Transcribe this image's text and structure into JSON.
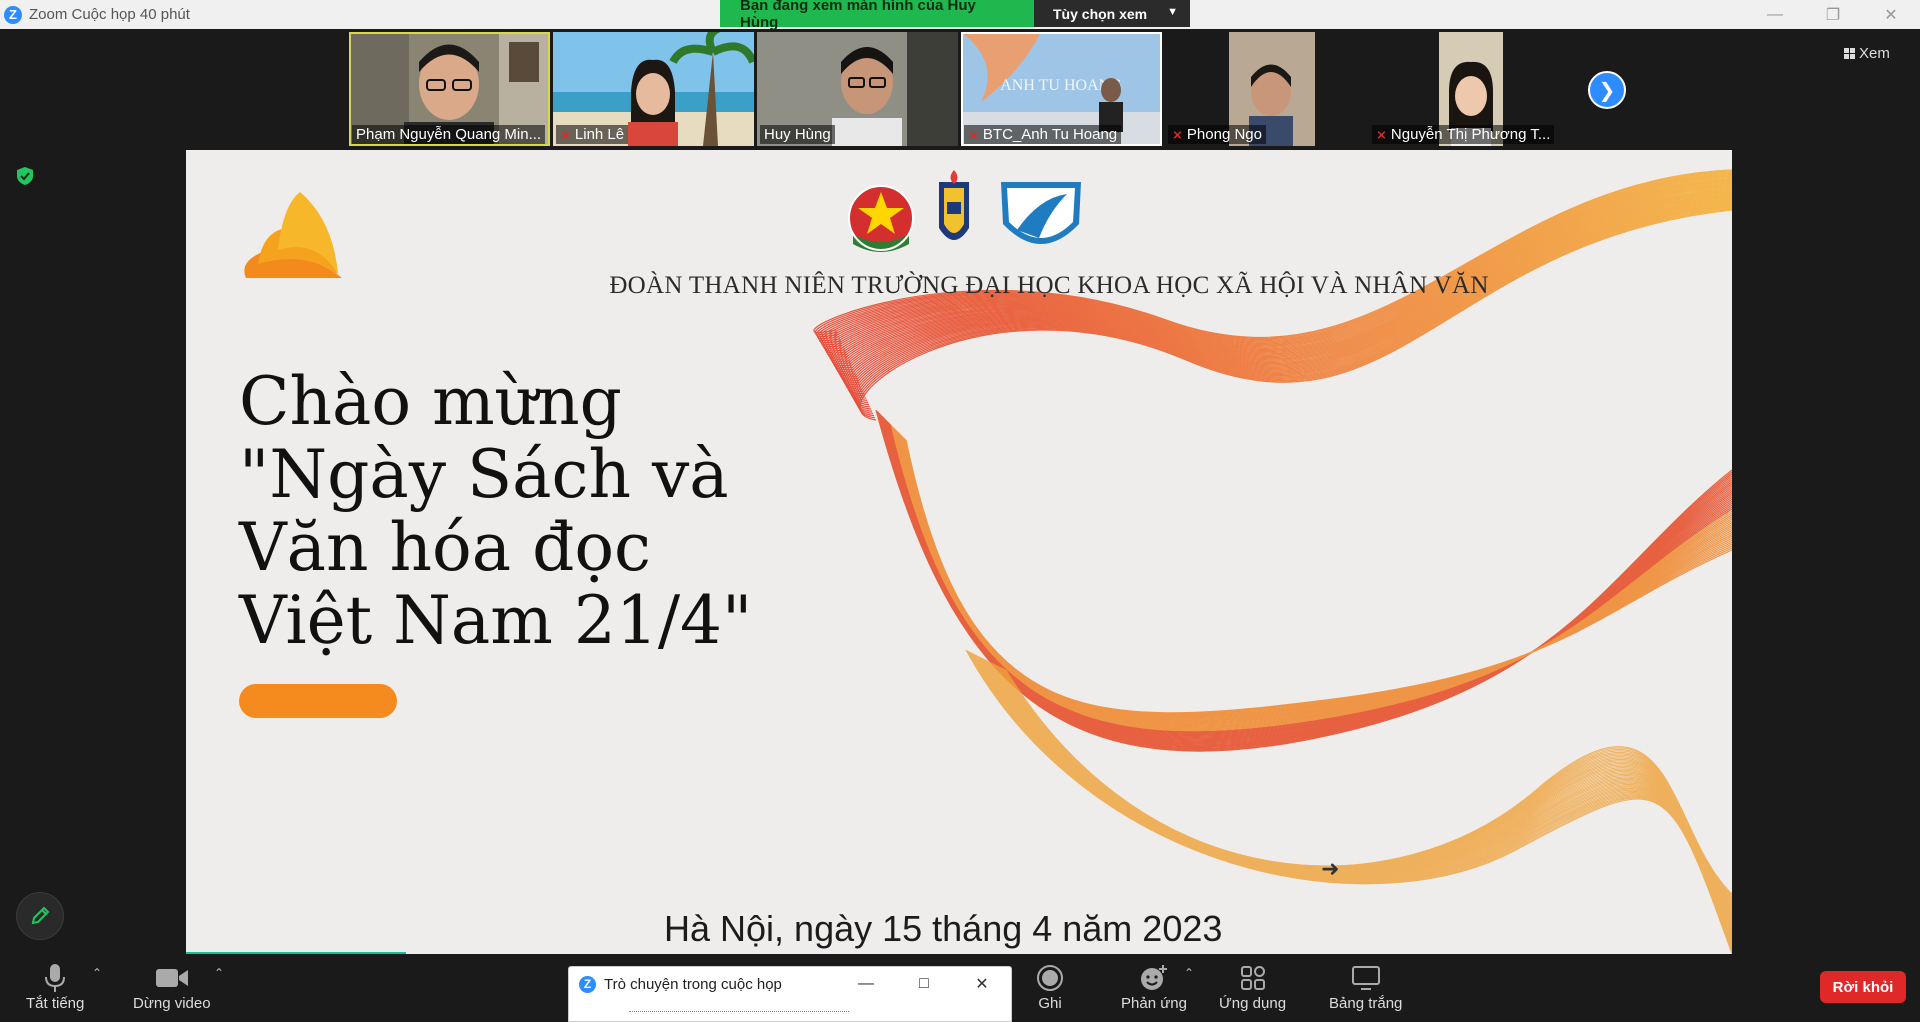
{
  "window": {
    "title": "Zoom Cuộc họp 40 phút",
    "share_banner": "Bạn đang xem màn hình của Huy Hùng",
    "view_options": "Tùy chọn xem"
  },
  "participants": [
    {
      "name": "Phạm Nguyễn Quang Min...",
      "muted": false,
      "active": true
    },
    {
      "name": "Linh Lê",
      "muted": true,
      "active": false
    },
    {
      "name": "Huy Hùng",
      "muted": false,
      "active": false
    },
    {
      "name": "BTC_Anh Tu Hoang",
      "muted": true,
      "active": false
    },
    {
      "name": "Phong Ngo",
      "muted": true,
      "active": false
    },
    {
      "name": "Nguyễn Thị Phương T...",
      "muted": true,
      "active": false
    }
  ],
  "view_button": "Xem",
  "slide": {
    "org_title": "ĐOÀN THANH NIÊN TRƯỜNG ĐẠI HỌC KHOA HỌC XÃ HỘI VÀ NHÂN VĂN",
    "headline": [
      "Chào mừng",
      "\"Ngày Sách và",
      "Văn hóa đọc",
      "Việt Nam 21/4\""
    ],
    "date_line": "Hà Nội, ngày 15 tháng 4 năm 2023",
    "emblem_text": "ANH TU HOANG"
  },
  "toolbar": {
    "mute": "Tắt tiếng",
    "stop_video": "Dừng video",
    "record": "Ghi",
    "reactions": "Phản ứng",
    "apps": "Ứng dụng",
    "whiteboard": "Bảng trắng",
    "leave": "Rời khỏi"
  },
  "chat": {
    "title": "Trò chuyện trong cuộc họp"
  },
  "colors": {
    "zoom_blue": "#2d8cff",
    "banner_green": "#1fb84e",
    "leave_red": "#e02828",
    "slide_orange": "#f58a1f"
  }
}
